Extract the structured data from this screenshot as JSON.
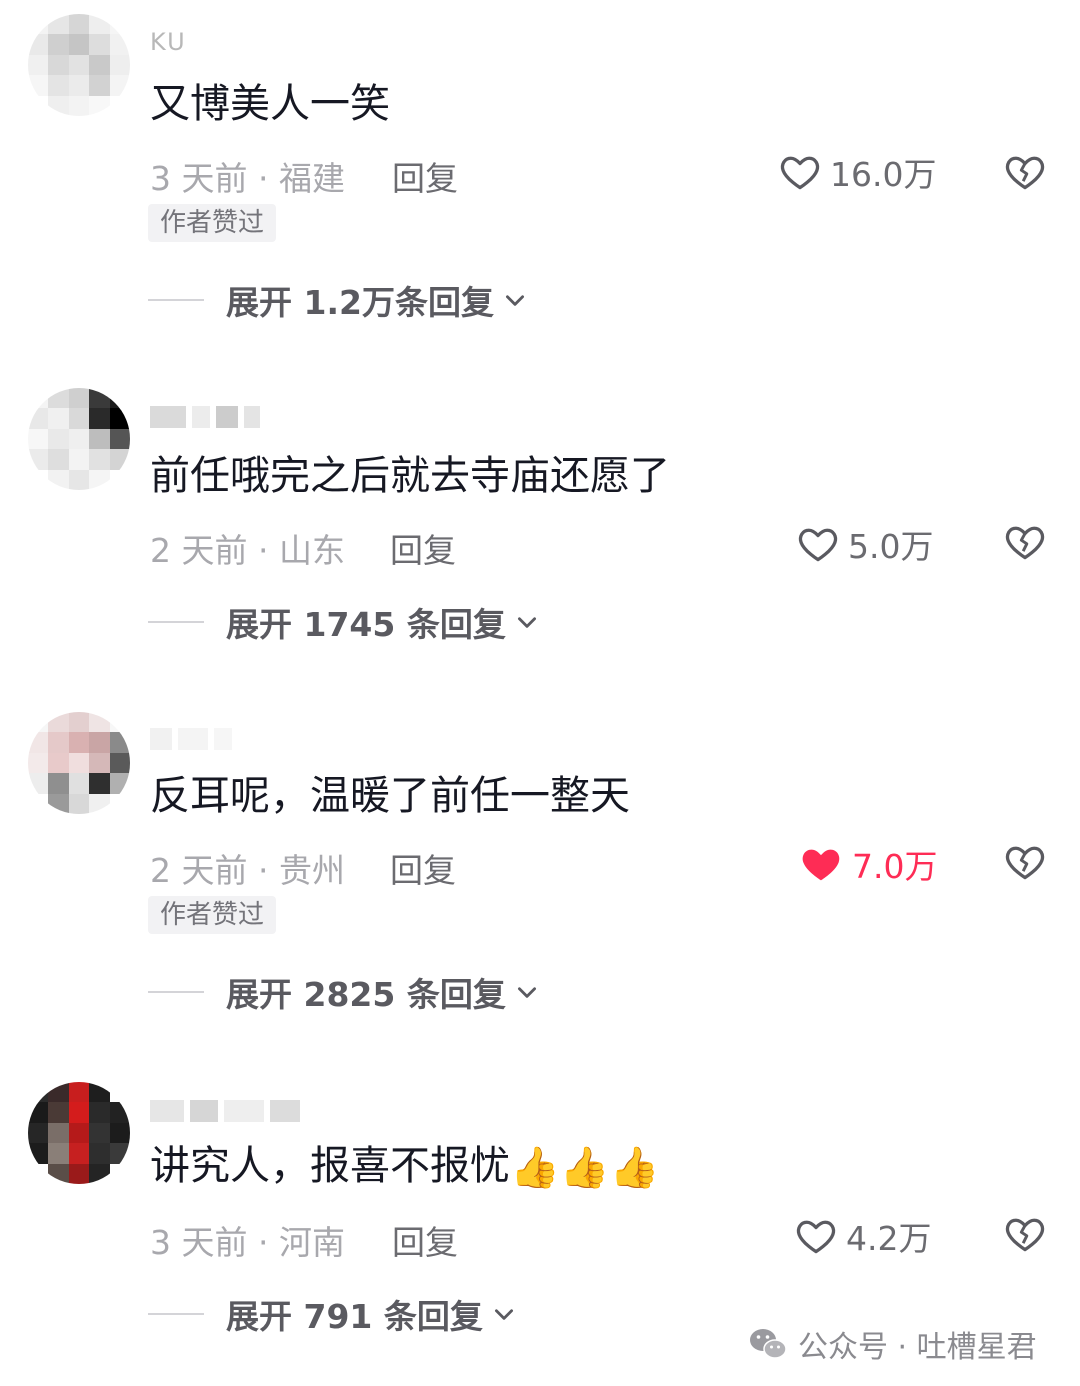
{
  "comments": [
    {
      "username": "KU",
      "text": "又博美人一笑",
      "meta": "3 天前 · 福建",
      "reply_label": "回复",
      "likes": "16.0万",
      "liked": false,
      "author_liked_badge": "作者赞过",
      "expand_label": "展开 1.2万条回复"
    },
    {
      "username": "",
      "text": "前任哦完之后就去寺庙还愿了",
      "meta": "2 天前 · 山东",
      "reply_label": "回复",
      "likes": "5.0万",
      "liked": false,
      "author_liked_badge": "",
      "expand_label": "展开 1745 条回复"
    },
    {
      "username": "",
      "text": "反耳呢，温暖了前任一整天",
      "meta": "2 天前 · 贵州",
      "reply_label": "回复",
      "likes": "7.0万",
      "liked": true,
      "author_liked_badge": "作者赞过",
      "expand_label": "展开 2825 条回复"
    },
    {
      "username": "",
      "text": "讲究人，报喜不报忧",
      "emojis": [
        "👍",
        "👍",
        "👍"
      ],
      "meta": "3 天前 · 河南",
      "reply_label": "回复",
      "likes": "4.2万",
      "liked": false,
      "author_liked_badge": "",
      "expand_label": "展开 791 条回复"
    }
  ],
  "watermark": {
    "icon": "wechat-icon",
    "text": "公众号 · 吐槽星君"
  },
  "colors": {
    "liked_heart": "#fe2c55",
    "text_primary": "#161823",
    "text_meta": "#a8a8ad"
  }
}
